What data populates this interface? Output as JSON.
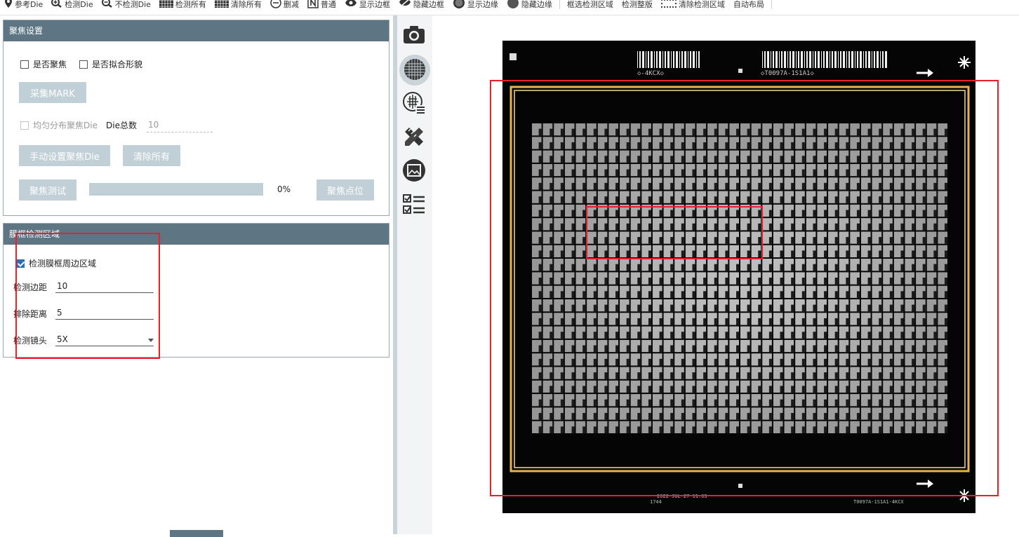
{
  "toolbar": {
    "items": [
      {
        "icon": "map-pin-icon",
        "label": "参考Die"
      },
      {
        "icon": "zoom-in-icon",
        "label": "检测Die"
      },
      {
        "icon": "zoom-out-icon",
        "label": "不检测Die"
      },
      {
        "icon": "grid-fill-icon",
        "label": "检测所有"
      },
      {
        "icon": "grid-clear-icon",
        "label": "清除所有"
      },
      {
        "icon": "minus-circle-icon",
        "label": "删减"
      },
      {
        "icon": "n-box-icon",
        "label": "普通"
      },
      {
        "icon": "eye-icon",
        "label": "显示边框"
      },
      {
        "icon": "eye-off-icon",
        "label": "隐藏边框"
      },
      {
        "icon": "circle-outline-icon",
        "label": "显示边缘"
      },
      {
        "icon": "circle-fill-icon",
        "label": "隐藏边缘"
      },
      {
        "icon": "",
        "label": "框选检测区域"
      },
      {
        "icon": "",
        "label": "检测整版"
      },
      {
        "icon": "dotted-grid-icon",
        "label": "清除检测区域"
      },
      {
        "icon": "",
        "label": "自动布局"
      }
    ]
  },
  "focus": {
    "title": "聚焦设置",
    "enable_focus": "是否聚焦",
    "fit_shape": "是否拟合形貌",
    "collect_mark": "采集MARK",
    "even_distribute": "均匀分布聚焦Die",
    "die_total_label": "Die总数",
    "die_total_value": "10",
    "manual_set": "手动设置聚焦Die",
    "clear_all": "清除所有",
    "focus_test": "聚焦测试",
    "progress_percent": 0,
    "progress_text": "0%",
    "focus_point": "聚焦点位"
  },
  "frame": {
    "title": "膜框检测区域",
    "detect_label": "检测膜框周边区域",
    "detect_checked": true,
    "margin_label": "检测边距",
    "margin_value": "10",
    "exclude_label": "排除距离",
    "exclude_value": "5",
    "lens_label": "检测镜头",
    "lens_value": "5X"
  },
  "side_tools": [
    {
      "icon": "camera-icon",
      "active": false
    },
    {
      "icon": "wafer-grid-icon",
      "active": true
    },
    {
      "icon": "wafer-list-icon",
      "active": false
    },
    {
      "icon": "ruler-pencil-icon",
      "active": false
    },
    {
      "icon": "image-frame-icon",
      "active": false
    },
    {
      "icon": "checklist-icon",
      "active": false
    }
  ],
  "wafer": {
    "barcode_left": "◇-4KCX◇",
    "barcode_right": "◇T0097A-1S1A1◇",
    "bottom_text_center": "2022-JUL-27 11:03",
    "bottom_text_center2": "1744",
    "bottom_text_right": "T0097A-1S1A1-4KCX"
  },
  "colors": {
    "header": "#5e7684",
    "button": "#c1cfd6",
    "highlight": "#e8202a",
    "frame_gold": "#e8b44a"
  }
}
